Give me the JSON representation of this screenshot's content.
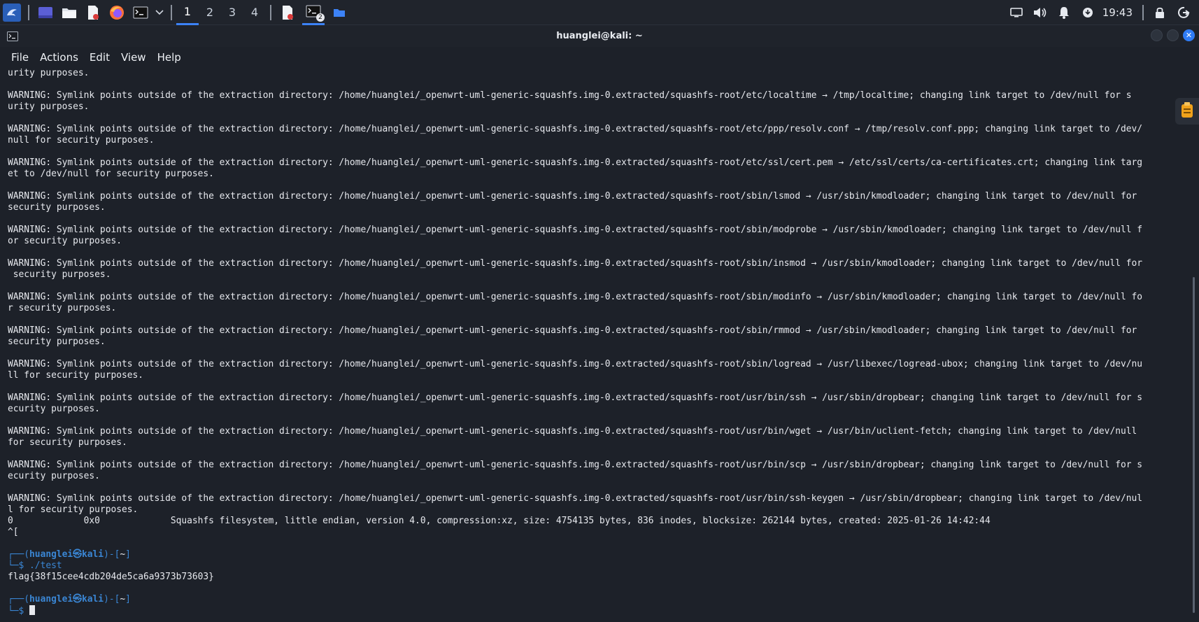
{
  "taskbar": {
    "workspaces": [
      "1",
      "2",
      "3",
      "4"
    ],
    "active_workspace": "1",
    "terminal_badge": "2",
    "clock": "19:43",
    "icons": [
      "kali-dragon-icon",
      "desktop-icon",
      "file-manager-icon",
      "text-editor-icon",
      "firefox-icon",
      "terminal-icon",
      "dropdown-chevron-icon",
      "screenshot-app-icon",
      "terminal-window-icon",
      "folder-window-icon",
      "display-icon",
      "volume-icon",
      "notification-bell-icon",
      "update-icon",
      "lock-icon",
      "power-icon"
    ],
    "colors": {
      "accent": "#3c82f6",
      "background": "#20242c"
    }
  },
  "window": {
    "title": "huanglei@kali: ~",
    "menu": [
      "File",
      "Actions",
      "Edit",
      "View",
      "Help"
    ]
  },
  "terminal": {
    "lines": [
      "urity purposes.",
      "",
      "WARNING: Symlink points outside of the extraction directory: /home/huanglei/_openwrt-uml-generic-squashfs.img-0.extracted/squashfs-root/etc/localtime → /tmp/localtime; changing link target to /dev/null for s",
      "urity purposes.",
      "",
      "WARNING: Symlink points outside of the extraction directory: /home/huanglei/_openwrt-uml-generic-squashfs.img-0.extracted/squashfs-root/etc/ppp/resolv.conf → /tmp/resolv.conf.ppp; changing link target to /dev/",
      "null for security purposes.",
      "",
      "WARNING: Symlink points outside of the extraction directory: /home/huanglei/_openwrt-uml-generic-squashfs.img-0.extracted/squashfs-root/etc/ssl/cert.pem → /etc/ssl/certs/ca-certificates.crt; changing link targ",
      "et to /dev/null for security purposes.",
      "",
      "WARNING: Symlink points outside of the extraction directory: /home/huanglei/_openwrt-uml-generic-squashfs.img-0.extracted/squashfs-root/sbin/lsmod → /usr/sbin/kmodloader; changing link target to /dev/null for",
      "security purposes.",
      "",
      "WARNING: Symlink points outside of the extraction directory: /home/huanglei/_openwrt-uml-generic-squashfs.img-0.extracted/squashfs-root/sbin/modprobe → /usr/sbin/kmodloader; changing link target to /dev/null f",
      "or security purposes.",
      "",
      "WARNING: Symlink points outside of the extraction directory: /home/huanglei/_openwrt-uml-generic-squashfs.img-0.extracted/squashfs-root/sbin/insmod → /usr/sbin/kmodloader; changing link target to /dev/null for",
      " security purposes.",
      "",
      "WARNING: Symlink points outside of the extraction directory: /home/huanglei/_openwrt-uml-generic-squashfs.img-0.extracted/squashfs-root/sbin/modinfo → /usr/sbin/kmodloader; changing link target to /dev/null fo",
      "r security purposes.",
      "",
      "WARNING: Symlink points outside of the extraction directory: /home/huanglei/_openwrt-uml-generic-squashfs.img-0.extracted/squashfs-root/sbin/rmmod → /usr/sbin/kmodloader; changing link target to /dev/null for",
      "security purposes.",
      "",
      "WARNING: Symlink points outside of the extraction directory: /home/huanglei/_openwrt-uml-generic-squashfs.img-0.extracted/squashfs-root/sbin/logread → /usr/libexec/logread-ubox; changing link target to /dev/nu",
      "ll for security purposes.",
      "",
      "WARNING: Symlink points outside of the extraction directory: /home/huanglei/_openwrt-uml-generic-squashfs.img-0.extracted/squashfs-root/usr/bin/ssh → /usr/sbin/dropbear; changing link target to /dev/null for s",
      "ecurity purposes.",
      "",
      "WARNING: Symlink points outside of the extraction directory: /home/huanglei/_openwrt-uml-generic-squashfs.img-0.extracted/squashfs-root/usr/bin/wget → /usr/bin/uclient-fetch; changing link target to /dev/null",
      "for security purposes.",
      "",
      "WARNING: Symlink points outside of the extraction directory: /home/huanglei/_openwrt-uml-generic-squashfs.img-0.extracted/squashfs-root/usr/bin/scp → /usr/sbin/dropbear; changing link target to /dev/null for s",
      "ecurity purposes.",
      "",
      "WARNING: Symlink points outside of the extraction directory: /home/huanglei/_openwrt-uml-generic-squashfs.img-0.extracted/squashfs-root/usr/bin/ssh-keygen → /usr/sbin/dropbear; changing link target to /dev/nul",
      "l for security purposes.",
      "0             0x0             Squashfs filesystem, little endian, version 4.0, compression:xz, size: 4754135 bytes, 836 inodes, blocksize: 262144 bytes, created: 2025-01-26 14:42:44",
      "^["
    ],
    "prompt1": {
      "frame_top": "┌──(",
      "user": "huanglei㉿kali",
      "mid": ")-[",
      "dir": "~",
      "end": "]",
      "frame_bottom": "└─$ ",
      "command": "./test"
    },
    "output": "flag{38f15cee4cdb204de5ca6a9373b73603}",
    "prompt2": {
      "frame_top": "┌──(",
      "user": "huanglei㉿kali",
      "mid": ")-[",
      "dir": "~",
      "end": "]",
      "frame_bottom": "└─$ "
    },
    "colors": {
      "prompt": "#3a86d4",
      "text": "#e7e9ee",
      "background": "#1d2129"
    }
  }
}
